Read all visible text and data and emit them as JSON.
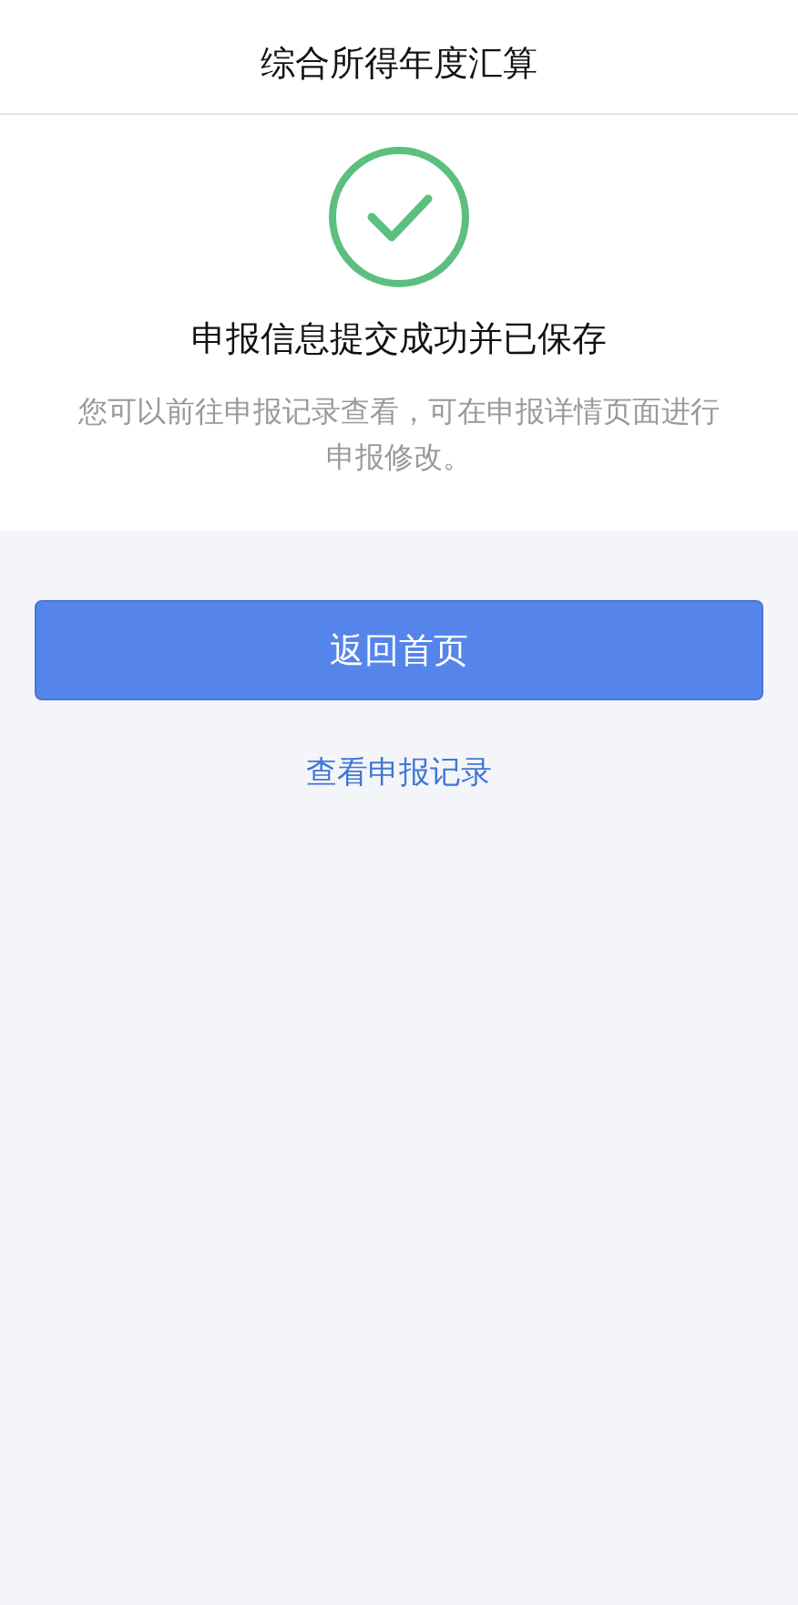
{
  "header": {
    "title": "综合所得年度汇算"
  },
  "result": {
    "title": "申报信息提交成功并已保存",
    "message": "您可以前往申报记录查看，可在申报详情页面进行申报修改。"
  },
  "buttons": [
    {
      "label": "返回首页",
      "kind": "primary"
    },
    {
      "label": "查看申报记录",
      "kind": "link"
    }
  ]
}
